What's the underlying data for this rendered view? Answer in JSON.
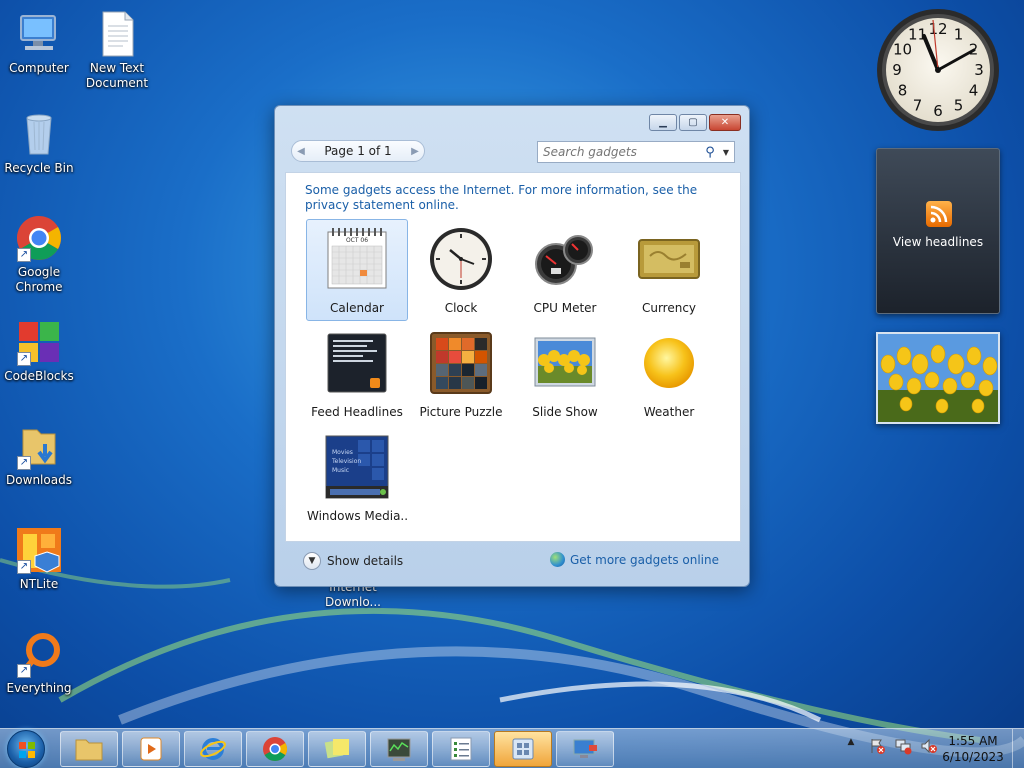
{
  "desktop": {
    "icons": [
      {
        "label": "Computer",
        "icon": "computer-icon"
      },
      {
        "label": "New Text Document",
        "icon": "text-document-icon"
      },
      {
        "label": "Recycle Bin",
        "icon": "recycle-bin-icon"
      },
      {
        "label": "Google Chrome",
        "icon": "chrome-icon"
      },
      {
        "label": "CodeBlocks",
        "icon": "codeblocks-icon"
      },
      {
        "label": "Downloads",
        "icon": "downloads-folder-icon"
      },
      {
        "label": "NTLite",
        "icon": "ntlite-icon"
      },
      {
        "label": "Everything",
        "icon": "everything-icon"
      }
    ],
    "partial_label": "Internet Downlo..."
  },
  "gallery": {
    "pager_text": "Page 1 of 1",
    "search_placeholder": "Search gadgets",
    "notice": "Some gadgets access the Internet.  For more information, see the privacy statement online.",
    "gadgets": [
      {
        "label": "Calendar",
        "selected": true
      },
      {
        "label": "Clock"
      },
      {
        "label": "CPU Meter"
      },
      {
        "label": "Currency"
      },
      {
        "label": "Feed Headlines"
      },
      {
        "label": "Picture Puzzle"
      },
      {
        "label": "Slide Show"
      },
      {
        "label": "Weather"
      },
      {
        "label": "Windows Media..."
      }
    ],
    "calendar_month": "OCT 06",
    "media_lines": [
      "Movies",
      "Television",
      "Music"
    ],
    "show_details": "Show details",
    "get_more": "Get more gadgets online"
  },
  "sidebar": {
    "feed_text": "View headlines",
    "clock_numbers": [
      "12",
      "1",
      "2",
      "3",
      "4",
      "5",
      "6",
      "7",
      "8",
      "9",
      "10",
      "11"
    ]
  },
  "taskbar": {
    "time": "1:55 AM",
    "date": "6/10/2023",
    "tray_arrow": "▲"
  },
  "colors": {
    "link": "#1a5fa8",
    "selection": "#cfe3fa",
    "taskbar_active": "#f0a53a"
  }
}
